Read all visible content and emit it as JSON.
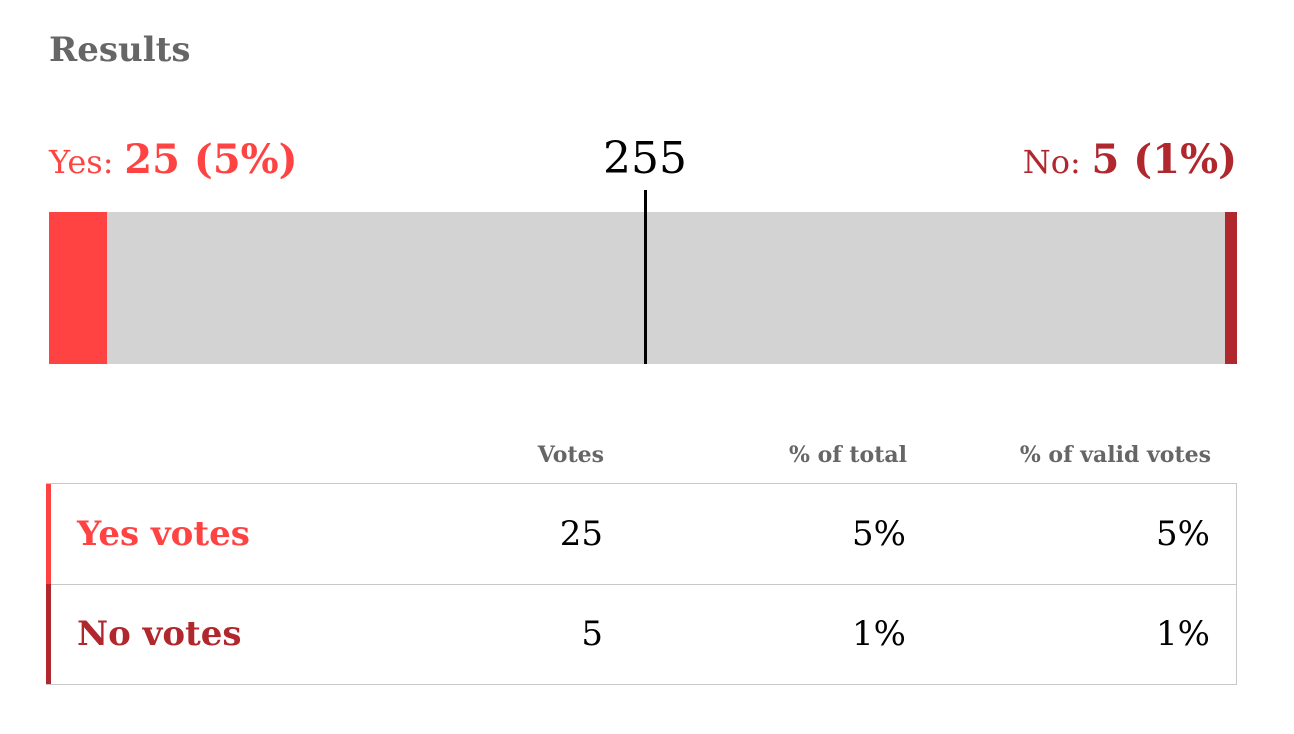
{
  "title": "Results",
  "yes": {
    "label": "Yes:",
    "value": "25 (5%)"
  },
  "no": {
    "label": "No:",
    "value": "5 (1%)"
  },
  "threshold": "255",
  "colors": {
    "yes": "#ff4343",
    "no": "#b0282e",
    "remaining": "#d3d3d3",
    "title": "#666666"
  },
  "chart_data": {
    "type": "bar",
    "orientation": "horizontal-stacked",
    "total": 510,
    "threshold": 255,
    "series": [
      {
        "name": "Yes",
        "values": [
          25
        ]
      },
      {
        "name": "No",
        "values": [
          5
        ]
      }
    ]
  },
  "table": {
    "headers": [
      "Votes",
      "% of total",
      "% of valid votes"
    ],
    "rows": [
      {
        "name": "Yes votes",
        "votes": "25",
        "pct_total": "5%",
        "pct_valid": "5%"
      },
      {
        "name": "No votes",
        "votes": "5",
        "pct_total": "1%",
        "pct_valid": "1%"
      }
    ]
  }
}
